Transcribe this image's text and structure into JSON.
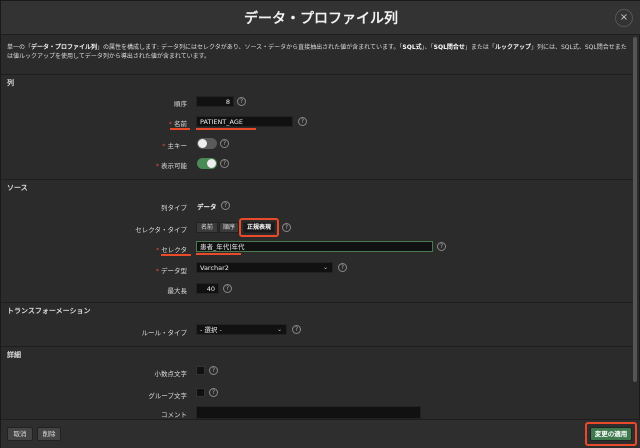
{
  "dialog": {
    "title": "データ・プロファイル列",
    "close_icon": "×",
    "description_parts": [
      "単一の「",
      "データ・プロファイル列",
      "」の属性を構成します: データ列にはセレクタがあり、ソース・データから直接抽出された値が含まれています。「",
      "SQL式",
      "」、「",
      "SQL問合せ",
      "」または「",
      "ルックアップ",
      "」列には、SQL式、SQL問合せまたは値ルックアップを使用してデータ列から導出された値が含まれています。"
    ]
  },
  "sections": {
    "column": "列",
    "source": "ソース",
    "transformation": "トランスフォーメーション",
    "details": "詳細"
  },
  "fields": {
    "sequence": {
      "label": "順序",
      "value": "8"
    },
    "name": {
      "label": "名前",
      "value": "PATIENT_AGE"
    },
    "primary_key": {
      "label": "主キー",
      "on": false
    },
    "visible": {
      "label": "表示可能",
      "on": true
    },
    "column_type": {
      "label": "列タイプ",
      "value": "データ"
    },
    "selector_type": {
      "label": "セレクタ・タイプ",
      "options": [
        "名前",
        "順序",
        "正規表現"
      ],
      "selected": "正規表現"
    },
    "selector": {
      "label": "セレクタ",
      "value": "患者_年代|年代"
    },
    "data_type": {
      "label": "データ型",
      "value": "Varchar2"
    },
    "max_length": {
      "label": "最大長",
      "value": "40"
    },
    "rule_type": {
      "label": "ルール・タイプ",
      "value": "- 選択 -"
    },
    "decimal_char": {
      "label": "小数点文字"
    },
    "group_char": {
      "label": "グループ文字"
    },
    "comment": {
      "label": "コメント"
    }
  },
  "help_glyph": "?",
  "caret_glyph": "⌄",
  "footer": {
    "cancel": "取消",
    "delete": "削除",
    "apply": "変更の適用"
  },
  "colors": {
    "highlight": "#e84a2a",
    "primary": "#3f7a4f",
    "toggle_on": "#4a8a55"
  }
}
